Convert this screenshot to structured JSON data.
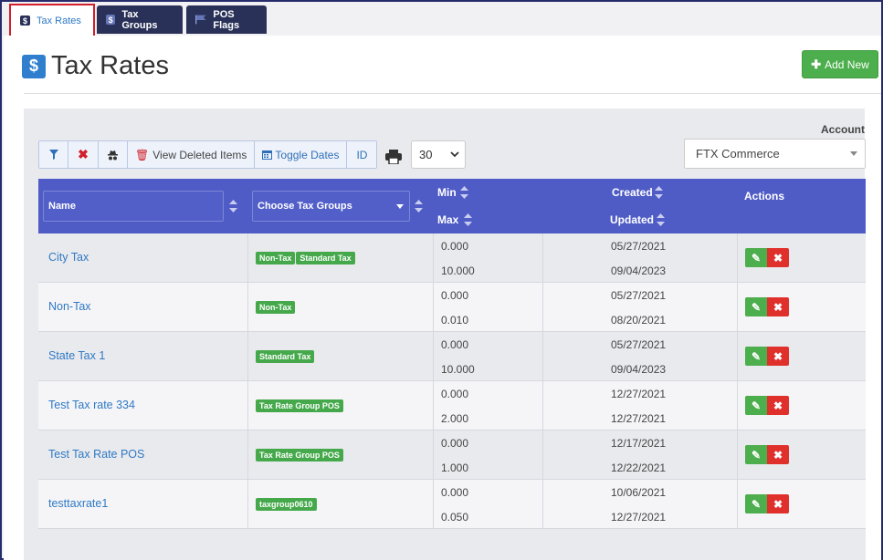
{
  "tabs": [
    {
      "label": "Tax Rates",
      "icon": "dollar-icon",
      "active": true
    },
    {
      "label": "Tax Groups",
      "icon": "dollar-icon",
      "active": false
    },
    {
      "label": "POS Flags",
      "icon": "flag-icon",
      "active": false
    }
  ],
  "page": {
    "title": "Tax Rates",
    "title_icon": "dollar-icon",
    "add_button": "Add New"
  },
  "toolbar": {
    "view_deleted": "View Deleted Items",
    "toggle_dates": "Toggle Dates",
    "id": "ID",
    "per_page": "30"
  },
  "account": {
    "label": "Account",
    "value": "FTX Commerce"
  },
  "table": {
    "name_placeholder": "Name",
    "group_placeholder": "Choose Tax Groups",
    "min_label": "Min",
    "max_label": "Max",
    "created_label": "Created",
    "updated_label": "Updated",
    "actions_label": "Actions",
    "rows": [
      {
        "name": "City Tax",
        "groups": [
          "Non-Tax",
          "Standard Tax"
        ],
        "min": "0.000",
        "max": "10.000",
        "created": "05/27/2021",
        "updated": "09/04/2023"
      },
      {
        "name": "Non-Tax",
        "groups": [
          "Non-Tax"
        ],
        "min": "0.000",
        "max": "0.010",
        "created": "05/27/2021",
        "updated": "08/20/2021"
      },
      {
        "name": "State Tax 1",
        "groups": [
          "Standard Tax"
        ],
        "min": "0.000",
        "max": "10.000",
        "created": "05/27/2021",
        "updated": "09/04/2023"
      },
      {
        "name": "Test Tax rate 334",
        "groups": [
          "Tax Rate Group POS"
        ],
        "min": "0.000",
        "max": "2.000",
        "created": "12/27/2021",
        "updated": "12/27/2021"
      },
      {
        "name": "Test Tax Rate POS",
        "groups": [
          "Tax Rate Group POS"
        ],
        "min": "0.000",
        "max": "1.000",
        "created": "12/17/2021",
        "updated": "12/22/2021"
      },
      {
        "name": "testtaxrate1",
        "groups": [
          "taxgroup0610"
        ],
        "min": "0.000",
        "max": "0.050",
        "created": "10/06/2021",
        "updated": "12/27/2021"
      }
    ]
  },
  "colors": {
    "header_blue": "#4f5cc6",
    "link_blue": "#2f79c3",
    "badge_green": "#45a94b",
    "danger_red": "#e0302c",
    "tab_dark": "#2a3158"
  }
}
